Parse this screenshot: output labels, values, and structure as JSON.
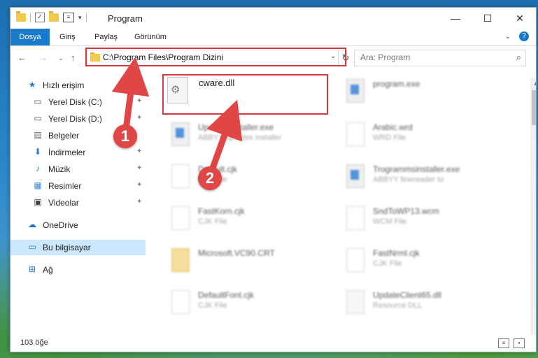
{
  "window": {
    "title": "Program"
  },
  "ribbon": {
    "tabs": [
      "Dosya",
      "Giriş",
      "Paylaş",
      "Görünüm"
    ]
  },
  "address": {
    "path": "C:\\Program Files\\Program Dizini"
  },
  "search": {
    "placeholder": "Ara: Program"
  },
  "nav": {
    "items": [
      {
        "label": "Hızlı erişim"
      },
      {
        "label": "Yerel Disk (C:)"
      },
      {
        "label": "Yerel Disk (D:)"
      },
      {
        "label": "Belgeler"
      },
      {
        "label": "İndirmeler"
      },
      {
        "label": "Müzik"
      },
      {
        "label": "Resimler"
      },
      {
        "label": "Videolar"
      },
      {
        "label": "OneDrive"
      },
      {
        "label": "Bu bilgisayar"
      },
      {
        "label": "Ağ"
      }
    ]
  },
  "files": [
    {
      "name": "cware.dll",
      "type": ""
    },
    {
      "name": "program.exe",
      "type": ""
    },
    {
      "name": "Updatesinstaller.exe",
      "type": "ABBYY updates installer"
    },
    {
      "name": "Arabic.wrd",
      "type": "WRD File"
    },
    {
      "name": "Default.cjk",
      "type": "CJK File"
    },
    {
      "name": "Trogrammsinstaller.exe",
      "type": "ABBYY finereader to"
    },
    {
      "name": "FastKorn.cjk",
      "type": "CJK File"
    },
    {
      "name": "SndToWP13.wcm",
      "type": "WCM File"
    },
    {
      "name": "Microsoft.VC90.CRT",
      "type": ""
    },
    {
      "name": "FastNrml.cjk",
      "type": "CJK File"
    },
    {
      "name": "DefaultFont.cjk",
      "type": "CJK File"
    },
    {
      "name": "UpdateClient65.dll",
      "type": "Resource DLL"
    }
  ],
  "status": {
    "count": "103 öğe"
  },
  "annotations": {
    "step1": "1",
    "step2": "2"
  },
  "colors": {
    "accent": "#1979ca",
    "highlight": "#d73a3a",
    "selected": "#cce8ff"
  }
}
